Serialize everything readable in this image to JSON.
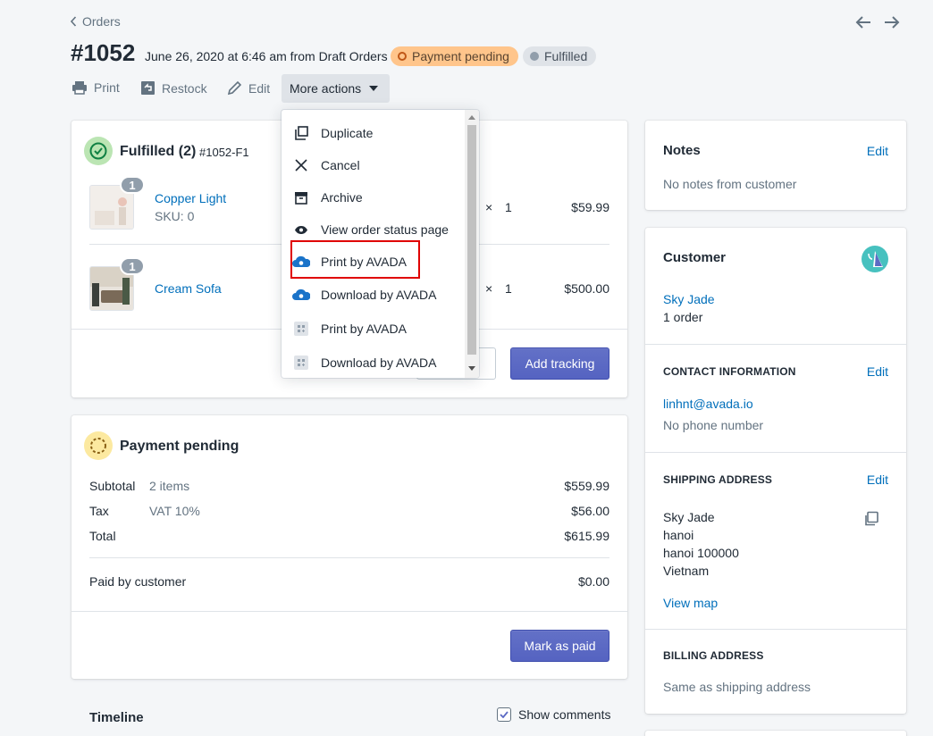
{
  "breadcrumb": {
    "label": "Orders"
  },
  "order": {
    "number": "#1052",
    "meta": "June 26, 2020 at 6:46 am from Draft Orders",
    "badges": {
      "payment": "Payment pending",
      "fulfillment": "Fulfilled"
    }
  },
  "actions": {
    "print": "Print",
    "restock": "Restock",
    "edit": "Edit",
    "more": "More actions"
  },
  "menu": {
    "items": [
      {
        "label": "Duplicate",
        "icon": "duplicate-icon"
      },
      {
        "label": "Cancel",
        "icon": "close-icon"
      },
      {
        "label": "Archive",
        "icon": "archive-icon"
      },
      {
        "label": "View order status page",
        "icon": "eye-icon"
      },
      {
        "label": "Print by AVADA",
        "icon": "avada-cloud-icon"
      },
      {
        "label": "Download by AVADA",
        "icon": "avada-cloud-icon"
      },
      {
        "label": "Print by AVADA",
        "icon": "app-placeholder-icon"
      },
      {
        "label": "Download by AVADA",
        "icon": "app-placeholder-icon"
      }
    ],
    "highlight_color": "#e00000"
  },
  "fulfilled": {
    "title": "Fulfilled (2)",
    "id": "#1052-F1",
    "items": [
      {
        "name": "Copper Light",
        "sku": "SKU: 0",
        "qty_badge": "1",
        "times": "×",
        "qty": "1",
        "price": "$59.99"
      },
      {
        "name": "Cream Sofa",
        "sku": "",
        "qty_badge": "1",
        "times": "×",
        "qty": "1",
        "price": "$500.00"
      }
    ],
    "add_tracking": "Add tracking"
  },
  "payment": {
    "title": "Payment pending",
    "rows": [
      {
        "label": "Subtotal",
        "detail": "2 items",
        "amount": "$559.99"
      },
      {
        "label": "Tax",
        "detail": "VAT 10%",
        "amount": "$56.00"
      },
      {
        "label": "Total",
        "detail": "",
        "amount": "$615.99"
      }
    ],
    "paid_label": "Paid by customer",
    "paid_amount": "$0.00",
    "mark_paid": "Mark as paid"
  },
  "timeline": {
    "title": "Timeline",
    "show_comments": "Show comments"
  },
  "notes": {
    "title": "Notes",
    "edit": "Edit",
    "text": "No notes from customer"
  },
  "customer": {
    "title": "Customer",
    "name": "Sky Jade",
    "orders": "1 order",
    "contact_title": "CONTACT INFORMATION",
    "contact_edit": "Edit",
    "email": "linhnt@avada.io",
    "phone": "No phone number",
    "shipping_title": "SHIPPING ADDRESS",
    "shipping_edit": "Edit",
    "address": [
      "Sky Jade",
      "hanoi",
      "hanoi 100000",
      "Vietnam"
    ],
    "view_map": "View map",
    "billing_title": "BILLING ADDRESS",
    "billing_text": "Same as shipping address"
  },
  "colors": {
    "primary": "#5c6ac4",
    "link": "#006fbb",
    "pending": "#ffc58b",
    "success": "#50b83c"
  }
}
